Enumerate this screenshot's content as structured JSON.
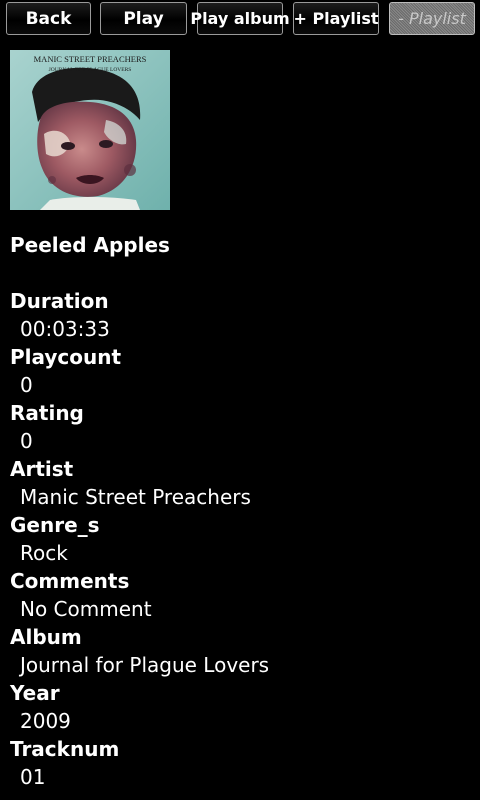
{
  "toolbar": {
    "back_label": "Back",
    "play_label": "Play",
    "play_album_label": "Play album",
    "add_playlist_label": "+ Playlist",
    "remove_playlist_label": "- Playlist"
  },
  "album_art": {
    "band_text": "MANIC STREET PREACHERS",
    "album_text": "JOURNAL FOR PLAGUE LOVERS"
  },
  "song": {
    "title": "Peeled Apples"
  },
  "fields": [
    {
      "label": "Duration",
      "value": "00:03:33"
    },
    {
      "label": "Playcount",
      "value": "0"
    },
    {
      "label": "Rating",
      "value": "0"
    },
    {
      "label": "Artist",
      "value": "Manic Street Preachers"
    },
    {
      "label": "Genre_s",
      "value": "Rock"
    },
    {
      "label": "Comments",
      "value": "No Comment"
    },
    {
      "label": "Album",
      "value": "Journal for Plague Lovers"
    },
    {
      "label": "Year",
      "value": "2009"
    },
    {
      "label": "Tracknum",
      "value": "01"
    }
  ],
  "colors": {
    "background": "#000000",
    "text": "#ffffff",
    "button_border": "#9a9a9a",
    "disabled_button": "#7a7a7a",
    "cover_background": "#8fc3c0"
  }
}
